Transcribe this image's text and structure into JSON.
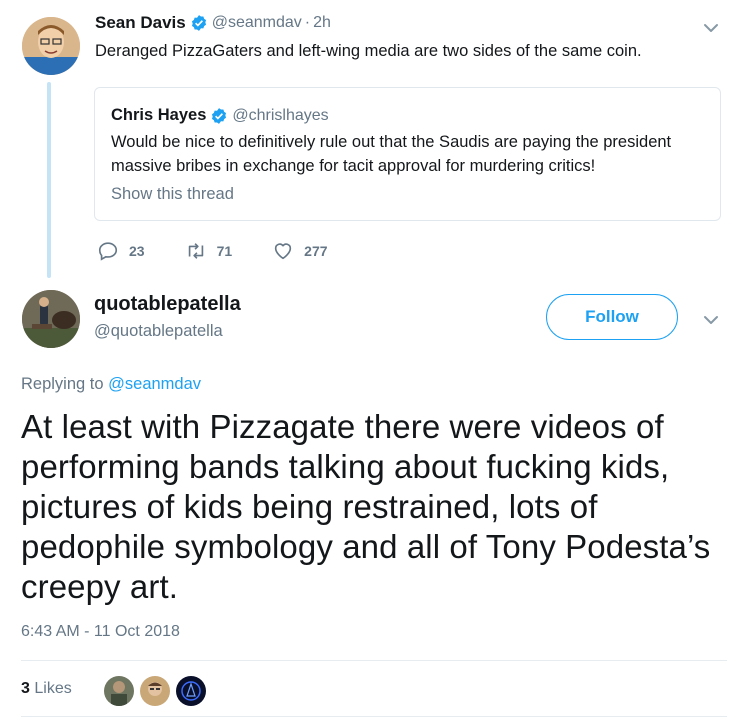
{
  "parent_tweet": {
    "name": "Sean Davis",
    "handle": "@seanmdav",
    "separator": "·",
    "time": "2h",
    "text": "Deranged PizzaGaters and left-wing media are two sides of the same coin.",
    "quoted_tweet": {
      "name": "Chris Hayes",
      "handle": "@chrislhayes",
      "text": "Would be nice to definitively rule out that the Saudis are paying the president massive bribes in exchange for tacit approval for murdering critics!",
      "show_thread": "Show this thread"
    },
    "actions": {
      "replies": "23",
      "retweets": "71",
      "likes": "277"
    }
  },
  "focused_tweet": {
    "name": "quotablepatella",
    "handle": "@quotablepatella",
    "follow_label": "Follow",
    "replying_prefix": "Replying to",
    "replying_to": "@seanmdav",
    "text": "At least with Pizzagate there were videos of performing bands talking about fucking kids, pictures of kids being restrained, lots of pedophile symbology and all of Tony Podesta’s creepy art.",
    "timestamp": "6:43 AM - 11 Oct 2018",
    "likes_count": "3",
    "likes_label": "Likes"
  },
  "colors": {
    "brand": "#1da1f2",
    "text": "#14171a",
    "secondary": "#657786",
    "thread_line": "#c4e4f6",
    "border": "#e1e8ed"
  },
  "icons": [
    "verified-badge-icon",
    "chevron-down-icon",
    "reply-icon",
    "retweet-icon",
    "heart-icon"
  ]
}
